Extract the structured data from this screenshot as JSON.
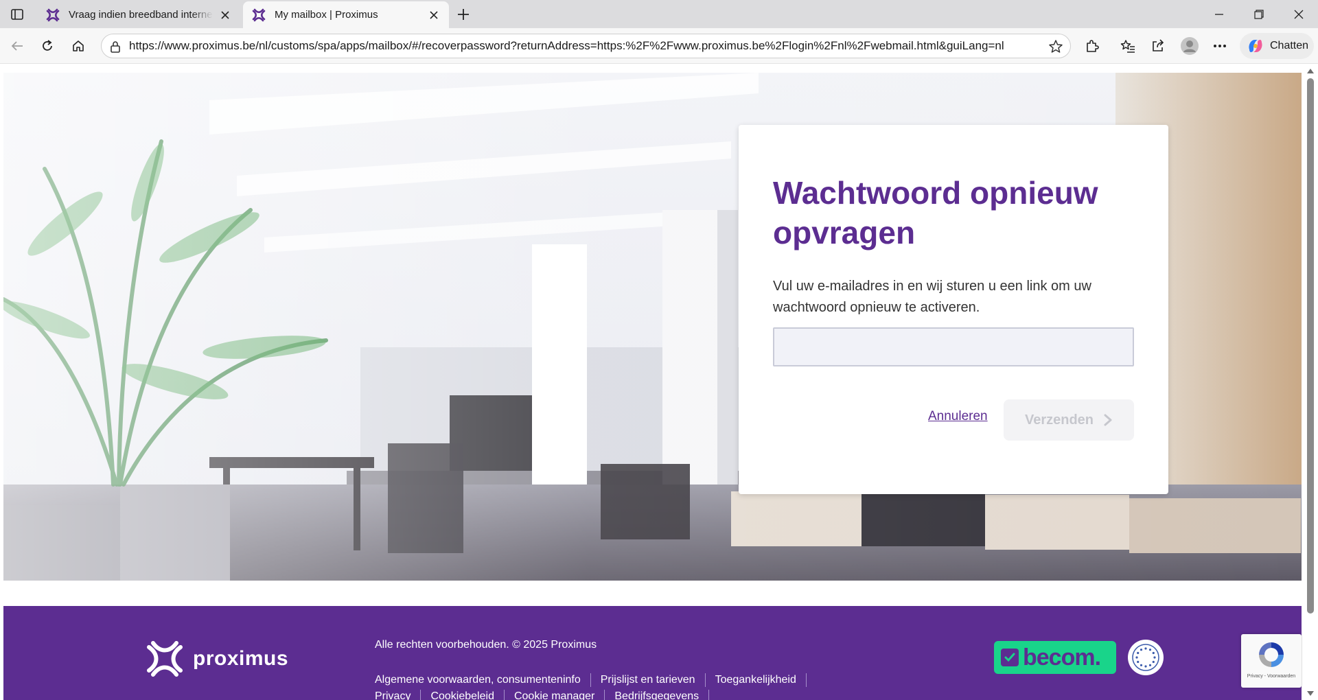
{
  "browser": {
    "tabs": [
      {
        "title": "Vraag indien breedband internet a",
        "active": false
      },
      {
        "title": "My mailbox | Proximus",
        "active": true
      }
    ],
    "url": "https://www.proximus.be/nl/customs/spa/apps/mailbox/#/recoverpassword?returnAddress=https:%2F%2Fwww.proximus.be%2Flogin%2Fnl%2Fwebmail.html&guiLang=nl",
    "chat_label": "Chatten"
  },
  "card": {
    "title": "Wachtwoord opnieuw opvragen",
    "intro": "Vul uw e-mailadres in en wij sturen u een link om uw wachtwoord opnieuw te activeren.",
    "email_value": "",
    "cancel_label": "Annuleren",
    "send_label": "Verzenden"
  },
  "footer": {
    "brand": "proximus",
    "copyright": "Alle rechten voorbehouden. © 2025 Proximus",
    "links": [
      "Algemene voorwaarden, consumenteninfo",
      "Prijslijst en tarieven",
      "Toegankelijkheid",
      "Privacy",
      "Cookiebeleid",
      "Cookie manager",
      "Bedrijfsgegevens"
    ],
    "becom_label": "becom."
  },
  "recaptcha": {
    "text": "Privacy - Voorwaarden"
  },
  "colors": {
    "brand_purple": "#5c2d91",
    "becom_green": "#19d48a",
    "button_disabled_bg": "#f3f3f5",
    "button_disabled_text": "#c6c7cd"
  }
}
